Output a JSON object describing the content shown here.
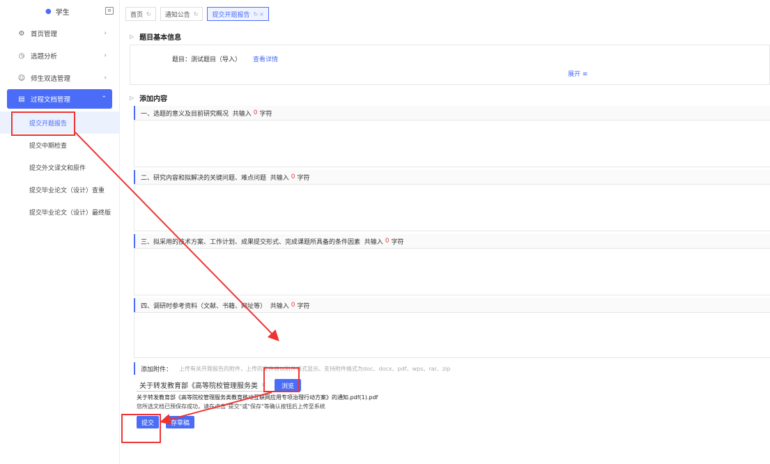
{
  "sidebar": {
    "user_label": "学生",
    "items": [
      {
        "icon": "gear-icon",
        "label": "首页管理"
      },
      {
        "icon": "clock-icon",
        "label": "选题分析"
      },
      {
        "icon": "users-icon",
        "label": "师生双选管理"
      },
      {
        "icon": "document-icon",
        "label": "过程文档管理"
      }
    ],
    "sub_items": [
      {
        "label": "提交开题报告"
      },
      {
        "label": "提交中期检查"
      },
      {
        "label": "提交外文译文和原件"
      },
      {
        "label": "提交毕业论文（设计）查重"
      },
      {
        "label": "提交毕业论文（设计）最终版"
      }
    ]
  },
  "tabs": [
    {
      "label": "首页"
    },
    {
      "label": "通知公告"
    },
    {
      "label": "提交开题报告"
    }
  ],
  "basic_info": {
    "title": "题目基本信息",
    "topic": "题目：测试题目（导入）",
    "view_details": "查看详情",
    "expand": "展开"
  },
  "content": {
    "title": "添加内容",
    "questions": [
      {
        "label": "一、选题的意义及目前研究概况",
        "count_prefix": "共输入",
        "count": "0",
        "count_suffix": "字符"
      },
      {
        "label": "二、研究内容和拟解决的关键问题、难点问题",
        "count_prefix": "共输入",
        "count": "0",
        "count_suffix": "字符"
      },
      {
        "label": "三、拟采用的技术方案、工作计划、成果提交形式、完成课题所具备的条件因素",
        "count_prefix": "共输入",
        "count": "0",
        "count_suffix": "字符"
      },
      {
        "label": "四、调研时参考资料（文献、书籍、网址等）",
        "count_prefix": "共输入",
        "count": "0",
        "count_suffix": "字符"
      }
    ]
  },
  "attachment": {
    "label": "添加附件：",
    "hint": "上传有关开题报告的附件，上传的文件将以附件格式显示。支持附件格式为doc、docx、pdf、wps、rar、zip",
    "file_input_value": "关于转发教育部《高等院校管理服务类",
    "browse": "浏览",
    "file_name": "关于转发教育部《高等院校管理服务类教育移动互联网应用专项治理行动方案》的通知.pdf(1).pdf",
    "note": "您所选文档已预保存成功，请在点击\"提交\"或\"保存\"等确认按钮后上传至系统"
  },
  "buttons": {
    "submit": "提交",
    "save_draft": "存草稿"
  },
  "colors": {
    "accent": "#4a6cf7",
    "annotation": "#e33333",
    "count": "#e23b3b"
  }
}
